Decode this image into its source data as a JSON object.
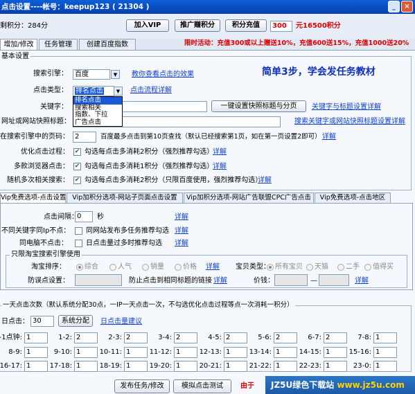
{
  "window": {
    "title": "点击设置----帐号：keepup123 ( 21304 )"
  },
  "top": {
    "points_label": "剩积分：",
    "points_value": "284分",
    "vip_button": "加入VIP",
    "promote_button": "推广赚积分",
    "recharge_button": "积分充值",
    "recharge_amount": "300",
    "recharge_result": "元16500积分",
    "promo_text": "限时活动：充值300或以上赠送10%，充值600送15%，充值1000送20%"
  },
  "tabs": [
    "增加/修改",
    "任务管理",
    "创建百度指数"
  ],
  "basic": {
    "group_title": "基本设置",
    "slogan": "简单3步，学会发任务教材",
    "engine_label": "搜索引擎：",
    "engine_value": "百度",
    "engine_link": "教你查看点击的效果",
    "click_type_label": "点击类型：",
    "click_type_value": "排名点击",
    "click_type_link": "点击流程详解",
    "click_type_options": [
      "排名点击",
      "搜索相关",
      "指数、下拉",
      "广告点击"
    ],
    "keyword_label": "关键字：",
    "keyword_value": "",
    "set_title_button": "一键设置快照标题与分页",
    "keyword_link": "关键字与标题设置详解",
    "snapshot_label": "网址或网站快照标题：",
    "snapshot_value": "",
    "snapshot_link": "搜索关键字或网站快照标题设置详解",
    "page_label": "在搜索引擎中的页码：",
    "page_value": "2",
    "page_desc": "百度最多点击到第10页查找（默认已经搜索第1页，如在第一页设置2即可）",
    "page_link": "详解",
    "opt1_label": "优化点击过程：",
    "opt1_text": "勾选每点击多消耗2积分（强烈推荐勾选）",
    "opt1_link": "详解",
    "opt2_label": "多款浏览器点击：",
    "opt2_text": "勾选每点击多消耗1积分（强烈推荐勾选）",
    "opt2_link": "详解",
    "opt3_label": "随机多次相关搜索：",
    "opt3_text": "勾选每点击多消耗2积分（只限百度使用，强烈推荐勾选）",
    "opt3_link": "详解"
  },
  "subtabs": [
    "Vip免费选项-点击设置",
    "Vip加积分选项-网站子页面点击设置",
    "Vip加积分选项-网站广告联盟CPC广告点击",
    "Vip免费选项-点击地区"
  ],
  "vip": {
    "interval_label": "点击间隔：",
    "interval_value": "0",
    "interval_unit": "秒",
    "interval_link": "详解",
    "ip_label": "不同关键字同Ip不点：",
    "ip_text": "同网站发布多任务推荐勾选",
    "ip_link": "详解",
    "pc_label": "同电脑不点击：",
    "pc_text": "日点击量过多时推荐勾选",
    "pc_link": "详解",
    "taobao_title": "只限淘宝搜索引擎使用",
    "sort_label": "淘宝排序：",
    "sort_options": [
      "综合",
      "人气",
      "销量",
      "价格"
    ],
    "sort_link": "详解",
    "item_type_label": "宝贝类型：",
    "item_type_options": [
      "所有宝贝",
      "天猫",
      "二手",
      "值得买"
    ],
    "misclick_label": "防误点设置：",
    "misclick_text": "防止点击到相同标题的链接",
    "misclick_link": "详解",
    "price_label": "价钱：",
    "price_dash": "—",
    "price_link": "详解"
  },
  "daily": {
    "group_title": "一天点击次数（默认系统分配30点，一IP一天点击一次，不勾选优化点击过程等点一次消耗一积分）",
    "daily_label": "日点击：",
    "daily_value": "30",
    "assign_button": "系统分配",
    "suggest_link": "日点击量建议",
    "rows": [
      [
        {
          "label": "0-1点钟:",
          "value": "1"
        },
        {
          "label": "1-2:",
          "value": "2"
        },
        {
          "label": "2-3:",
          "value": "2"
        },
        {
          "label": "3-4:",
          "value": "2"
        },
        {
          "label": "4-5:",
          "value": "2"
        },
        {
          "label": "5-6:",
          "value": "2"
        },
        {
          "label": "6-7:",
          "value": "2"
        },
        {
          "label": "7-8:",
          "value": "1"
        }
      ],
      [
        {
          "label": "8-9:",
          "value": "1"
        },
        {
          "label": "9-10:",
          "value": "1"
        },
        {
          "label": "10-11:",
          "value": "1"
        },
        {
          "label": "11-12:",
          "value": "1"
        },
        {
          "label": "12-13:",
          "value": "1"
        },
        {
          "label": "13-14:",
          "value": "1"
        },
        {
          "label": "14-15:",
          "value": "1"
        },
        {
          "label": "15-16:",
          "value": "1"
        }
      ],
      [
        {
          "label": "16-17:",
          "value": "1"
        },
        {
          "label": "17-18:",
          "value": "1"
        },
        {
          "label": "18-19:",
          "value": "1"
        },
        {
          "label": "19-20:",
          "value": "1"
        },
        {
          "label": "20-21:",
          "value": "1"
        },
        {
          "label": "21-22:",
          "value": "1"
        },
        {
          "label": "22-23:",
          "value": "1"
        },
        {
          "label": "23-0:",
          "value": "1"
        }
      ]
    ]
  },
  "bottom": {
    "publish_button": "发布任务/修改",
    "simulate_button": "模拟点击测试",
    "note": "由于"
  },
  "watermark": {
    "site": "JZ5U绿色下载站",
    "url": "www.jz5u.com"
  }
}
